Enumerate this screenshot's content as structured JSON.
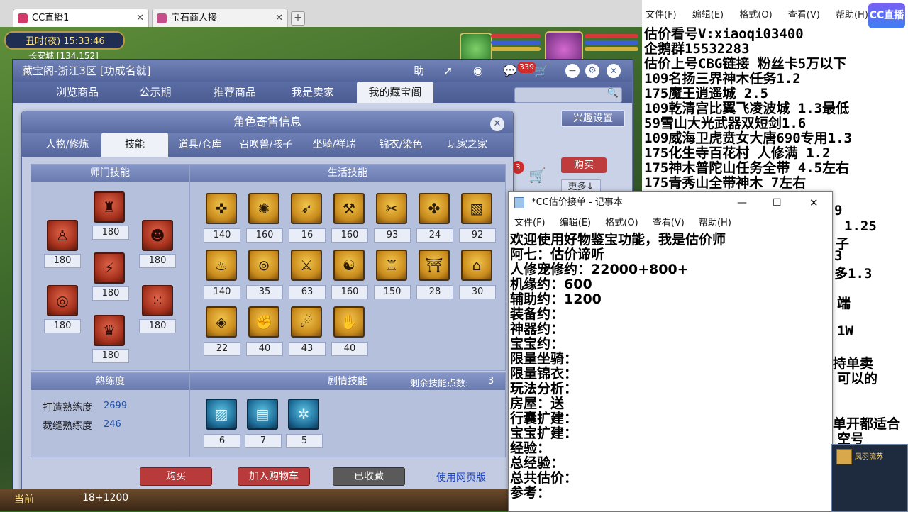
{
  "browser": {
    "tabs": [
      {
        "label": "CC直播1"
      },
      {
        "label": "宝石商人接"
      }
    ],
    "add_tab": "+"
  },
  "hud": {
    "time": "丑时(夜)  15:33:46",
    "coords": "长安城 [134,152]",
    "bottom_label": "当前",
    "bottom_coord": "18+1200"
  },
  "cbg": {
    "title": "藏宝阁-浙江3区 [功成名就]",
    "help": "助",
    "message_count": "339",
    "nav": [
      "浏览商品",
      "公示期",
      "推荐商品",
      "我是卖家",
      "我的藏宝阁"
    ],
    "hobby_button": "兴趣设置",
    "buy_button": "购买",
    "more_button": "更多↓",
    "cart_count": "3"
  },
  "dialog": {
    "title": "角色寄售信息",
    "close": "✕",
    "tabs": [
      "人物/修炼",
      "技能",
      "道具/仓库",
      "召唤兽/孩子",
      "坐骑/祥瑞",
      "锦衣/染色",
      "玩家之家"
    ],
    "active_tab": 1,
    "school_skills": {
      "header": "师门技能",
      "levels": [
        "180",
        "180",
        "180",
        "180",
        "180",
        "180",
        "180"
      ]
    },
    "life_skills": {
      "header": "生活技能",
      "levels": [
        "140",
        "160",
        "16",
        "160",
        "93",
        "24",
        "92",
        "140",
        "35",
        "63",
        "160",
        "150",
        "28",
        "30",
        "22",
        "40",
        "43",
        "40"
      ]
    },
    "proficiency": {
      "header": "熟练度",
      "items": [
        {
          "label": "打造熟练度",
          "value": "2699"
        },
        {
          "label": "裁缝熟练度",
          "value": "246"
        }
      ]
    },
    "story_skills": {
      "header": "剧情技能",
      "remaining_label": "剩余技能点数:",
      "remaining_value": "3",
      "levels": [
        "6",
        "7",
        "5"
      ]
    },
    "buttons": {
      "buy": "购买",
      "add_cart": "加入购物车",
      "collected": "已收藏",
      "web": "使用网页版"
    }
  },
  "stream": {
    "menu": [
      "文件(F)",
      "编辑(E)",
      "格式(O)",
      "查看(V)",
      "帮助(H)"
    ],
    "logo": "CC直播",
    "lines": [
      "估价看号V:xiaoqi03400",
      "企鹅群15532283",
      "估价上号CBG链接 粉丝卡5万以下",
      "109名扬三界神木任务1.2",
      "175魔王逍遥城 2.5",
      "109乾清宫比翼飞凌波城 1.3最低",
      "59雪山大光武器双短剑1.6",
      "109威海卫虎贲女大唐690专用1.3",
      "175化生寺百花村 人修满 1.2",
      "175神木普陀山任务全带 4.5左右",
      "175青秀山全带神木  7左右"
    ],
    "partial_lines": [
      "9",
      "1.25",
      "子",
      "3",
      "多1.3",
      "端",
      "1W",
      "持单卖",
      "可以的",
      "单开都适合",
      "空号"
    ]
  },
  "notepad": {
    "title": "*CC估价接单 - 记事本",
    "menu": [
      "文件(F)",
      "编辑(E)",
      "格式(O)",
      "查看(V)",
      "帮助(H)"
    ],
    "lines": [
      "欢迎使用好物鉴宝功能，我是估价师",
      "阿七：估价谛听",
      "人修宠修约：22000+800+",
      "机缘约：600",
      "辅助约：1200",
      "装备约：",
      "神器约：",
      "宝宝约：",
      "限量坐骑：",
      "限量锦衣：",
      "玩法分析：",
      "房屋：送",
      "行囊扩建：",
      "宝宝扩建：",
      "经验：",
      "总经验：",
      "总共估价：",
      "参考："
    ]
  },
  "mini_card": {
    "name": "凤羽流苏"
  },
  "colors": {
    "accent": "#5b6ca4",
    "buy_red": "#c03c3c",
    "collected_gray": "#5a5a5a",
    "link_blue": "#1d44c2"
  }
}
